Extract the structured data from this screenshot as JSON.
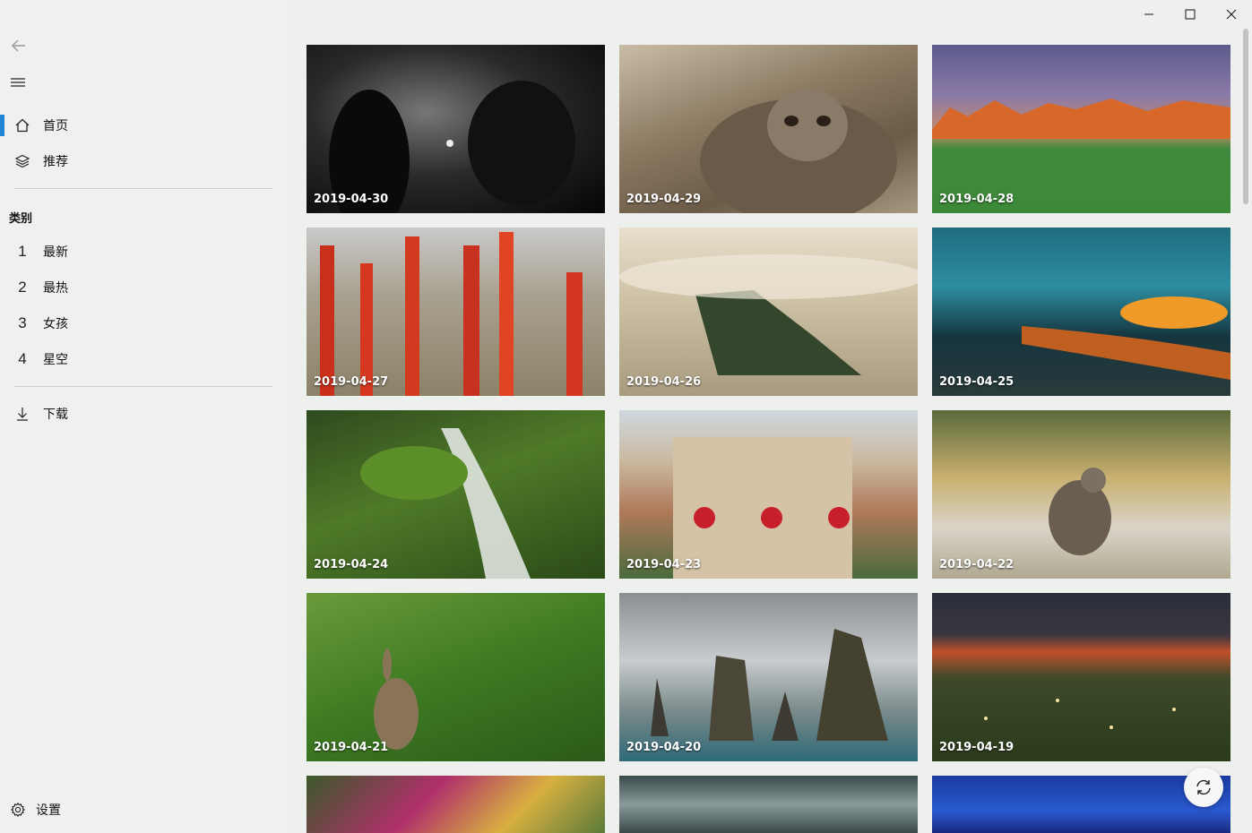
{
  "sidebar": {
    "nav": [
      {
        "label": "首页",
        "icon": "home-icon"
      },
      {
        "label": "推荐",
        "icon": "layers-icon"
      }
    ],
    "section_title": "类别",
    "categories": [
      {
        "num": "1",
        "label": "最新"
      },
      {
        "num": "2",
        "label": "最热"
      },
      {
        "num": "3",
        "label": "女孩"
      },
      {
        "num": "4",
        "label": "星空"
      }
    ],
    "download": {
      "label": "下载",
      "icon": "download-icon"
    },
    "settings": {
      "label": "设置",
      "icon": "gear-icon"
    },
    "accent": "#1e88d6"
  },
  "gallery": {
    "tiles": [
      {
        "date": "2019-04-30"
      },
      {
        "date": "2019-04-29"
      },
      {
        "date": "2019-04-28"
      },
      {
        "date": "2019-04-27"
      },
      {
        "date": "2019-04-26"
      },
      {
        "date": "2019-04-25"
      },
      {
        "date": "2019-04-24"
      },
      {
        "date": "2019-04-23"
      },
      {
        "date": "2019-04-22"
      },
      {
        "date": "2019-04-21"
      },
      {
        "date": "2019-04-20"
      },
      {
        "date": "2019-04-19"
      },
      {
        "date": ""
      },
      {
        "date": ""
      },
      {
        "date": ""
      }
    ]
  }
}
